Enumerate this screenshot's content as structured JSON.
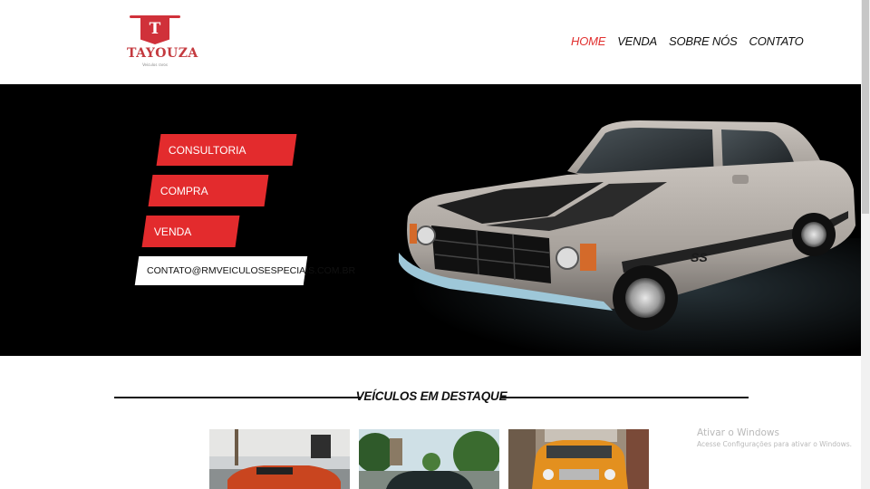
{
  "logo": {
    "letter": "T",
    "name": "TAYOUZA",
    "tagline": "Veículos raros"
  },
  "nav": {
    "items": [
      {
        "label": "HOME",
        "active": true
      },
      {
        "label": "VENDA",
        "active": false
      },
      {
        "label": "SOBRE NÓS",
        "active": false
      },
      {
        "label": "CONTATO",
        "active": false
      }
    ]
  },
  "hero": {
    "buttons": [
      "CONSULTORIA",
      "COMPRA",
      "VENDA"
    ],
    "contact_email": "CONTATO@RMVEICULOSESPECIAIS.COM.BR",
    "car_badge": "SS"
  },
  "section": {
    "title": "VEÍCULOS EM DESTAQUE"
  },
  "watermark": {
    "line1": "Ativar o Windows",
    "line2": "Acesse Configurações para ativar o Windows."
  },
  "colors": {
    "accent": "#e32b2d",
    "hero_bg": "#000000",
    "nav_active": "#e1302f"
  }
}
